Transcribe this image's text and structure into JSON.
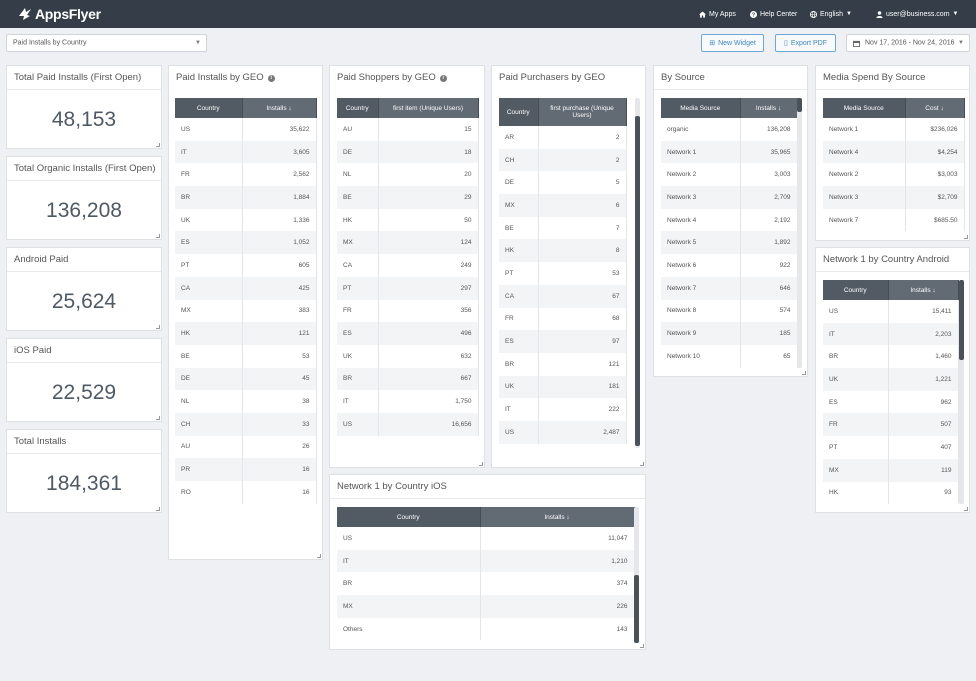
{
  "header": {
    "logo_text": "AppsFlyer",
    "my_apps": "My Apps",
    "help_center": "Help Center",
    "language": "English",
    "user": "user@business.com"
  },
  "toolbar": {
    "dashboard_select": "Paid Installs by Country",
    "new_widget": "New Widget",
    "export_pdf": "Export PDF",
    "date_range": "Nov 17, 2016 - Nov 24, 2016"
  },
  "kpis": [
    {
      "title": "Total Paid Installs (First Open)",
      "value": "48,153"
    },
    {
      "title": "Total Organic Installs (First Open)",
      "value": "136,208"
    },
    {
      "title": "Android Paid",
      "value": "25,624"
    },
    {
      "title": "iOS Paid",
      "value": "22,529"
    },
    {
      "title": "Total Installs",
      "value": "184,361"
    }
  ],
  "paid_installs_geo": {
    "title": "Paid Installs by GEO",
    "col1": "Country",
    "col2": "Installs ↓",
    "rows": [
      [
        "US",
        "35,622"
      ],
      [
        "IT",
        "3,605"
      ],
      [
        "FR",
        "2,562"
      ],
      [
        "BR",
        "1,884"
      ],
      [
        "UK",
        "1,336"
      ],
      [
        "ES",
        "1,052"
      ],
      [
        "PT",
        "605"
      ],
      [
        "CA",
        "425"
      ],
      [
        "MX",
        "383"
      ],
      [
        "HK",
        "121"
      ],
      [
        "BE",
        "53"
      ],
      [
        "DE",
        "45"
      ],
      [
        "NL",
        "38"
      ],
      [
        "CH",
        "33"
      ],
      [
        "AU",
        "26"
      ],
      [
        "PR",
        "16"
      ],
      [
        "RO",
        "16"
      ]
    ]
  },
  "paid_shoppers_geo": {
    "title": "Paid Shoppers by GEO",
    "col1": "Country",
    "col2": "first item (Unique Users)",
    "rows": [
      [
        "AU",
        "15"
      ],
      [
        "DE",
        "18"
      ],
      [
        "NL",
        "20"
      ],
      [
        "BE",
        "29"
      ],
      [
        "HK",
        "50"
      ],
      [
        "MX",
        "124"
      ],
      [
        "CA",
        "249"
      ],
      [
        "PT",
        "297"
      ],
      [
        "FR",
        "356"
      ],
      [
        "ES",
        "496"
      ],
      [
        "UK",
        "632"
      ],
      [
        "BR",
        "667"
      ],
      [
        "IT",
        "1,750"
      ],
      [
        "US",
        "16,656"
      ]
    ]
  },
  "paid_purchasers_geo": {
    "title": "Paid Purchasers by GEO",
    "col1": "Country",
    "col2": "first purchase (Unique Users)",
    "rows": [
      [
        "AR",
        "2"
      ],
      [
        "CH",
        "2"
      ],
      [
        "DE",
        "5"
      ],
      [
        "MX",
        "6"
      ],
      [
        "BE",
        "7"
      ],
      [
        "HK",
        "8"
      ],
      [
        "PT",
        "53"
      ],
      [
        "CA",
        "67"
      ],
      [
        "FR",
        "68"
      ],
      [
        "ES",
        "97"
      ],
      [
        "BR",
        "121"
      ],
      [
        "UK",
        "181"
      ],
      [
        "IT",
        "222"
      ],
      [
        "US",
        "2,487"
      ]
    ]
  },
  "by_source": {
    "title": "By Source",
    "col1": "Media Source",
    "col2": "Installs ↓",
    "rows": [
      [
        "organic",
        "136,208"
      ],
      [
        "Network 1",
        "35,965"
      ],
      [
        "Network 2",
        "3,003"
      ],
      [
        "Network 3",
        "2,709"
      ],
      [
        "Network 4",
        "2,192"
      ],
      [
        "Network 5",
        "1,892"
      ],
      [
        "Network 6",
        "922"
      ],
      [
        "Network 7",
        "646"
      ],
      [
        "Network 8",
        "574"
      ],
      [
        "Network 9",
        "185"
      ],
      [
        "Network 10",
        "65"
      ]
    ]
  },
  "media_spend": {
    "title": "Media Spend By Source",
    "col1": "Media Source",
    "col2": "Cost ↓",
    "rows": [
      [
        "Network 1",
        "$236,026"
      ],
      [
        "Network 4",
        "$4,254"
      ],
      [
        "Network 2",
        "$3,003"
      ],
      [
        "Network 3",
        "$2,709"
      ],
      [
        "Network 7",
        "$685.50"
      ]
    ]
  },
  "network1_android": {
    "title": "Network 1 by Country Android",
    "col1": "Country",
    "col2": "Installs ↓",
    "rows": [
      [
        "US",
        "15,411"
      ],
      [
        "IT",
        "2,203"
      ],
      [
        "BR",
        "1,460"
      ],
      [
        "UK",
        "1,221"
      ],
      [
        "ES",
        "962"
      ],
      [
        "FR",
        "507"
      ],
      [
        "PT",
        "407"
      ],
      [
        "MX",
        "119"
      ],
      [
        "HK",
        "93"
      ]
    ]
  },
  "network1_ios": {
    "title": "Network 1 by Country iOS",
    "col1": "Country",
    "col2": "Installs ↓",
    "rows": [
      [
        "US",
        "11,047"
      ],
      [
        "IT",
        "1,210"
      ],
      [
        "BR",
        "374"
      ],
      [
        "MX",
        "226"
      ],
      [
        "Others",
        "143"
      ]
    ]
  }
}
